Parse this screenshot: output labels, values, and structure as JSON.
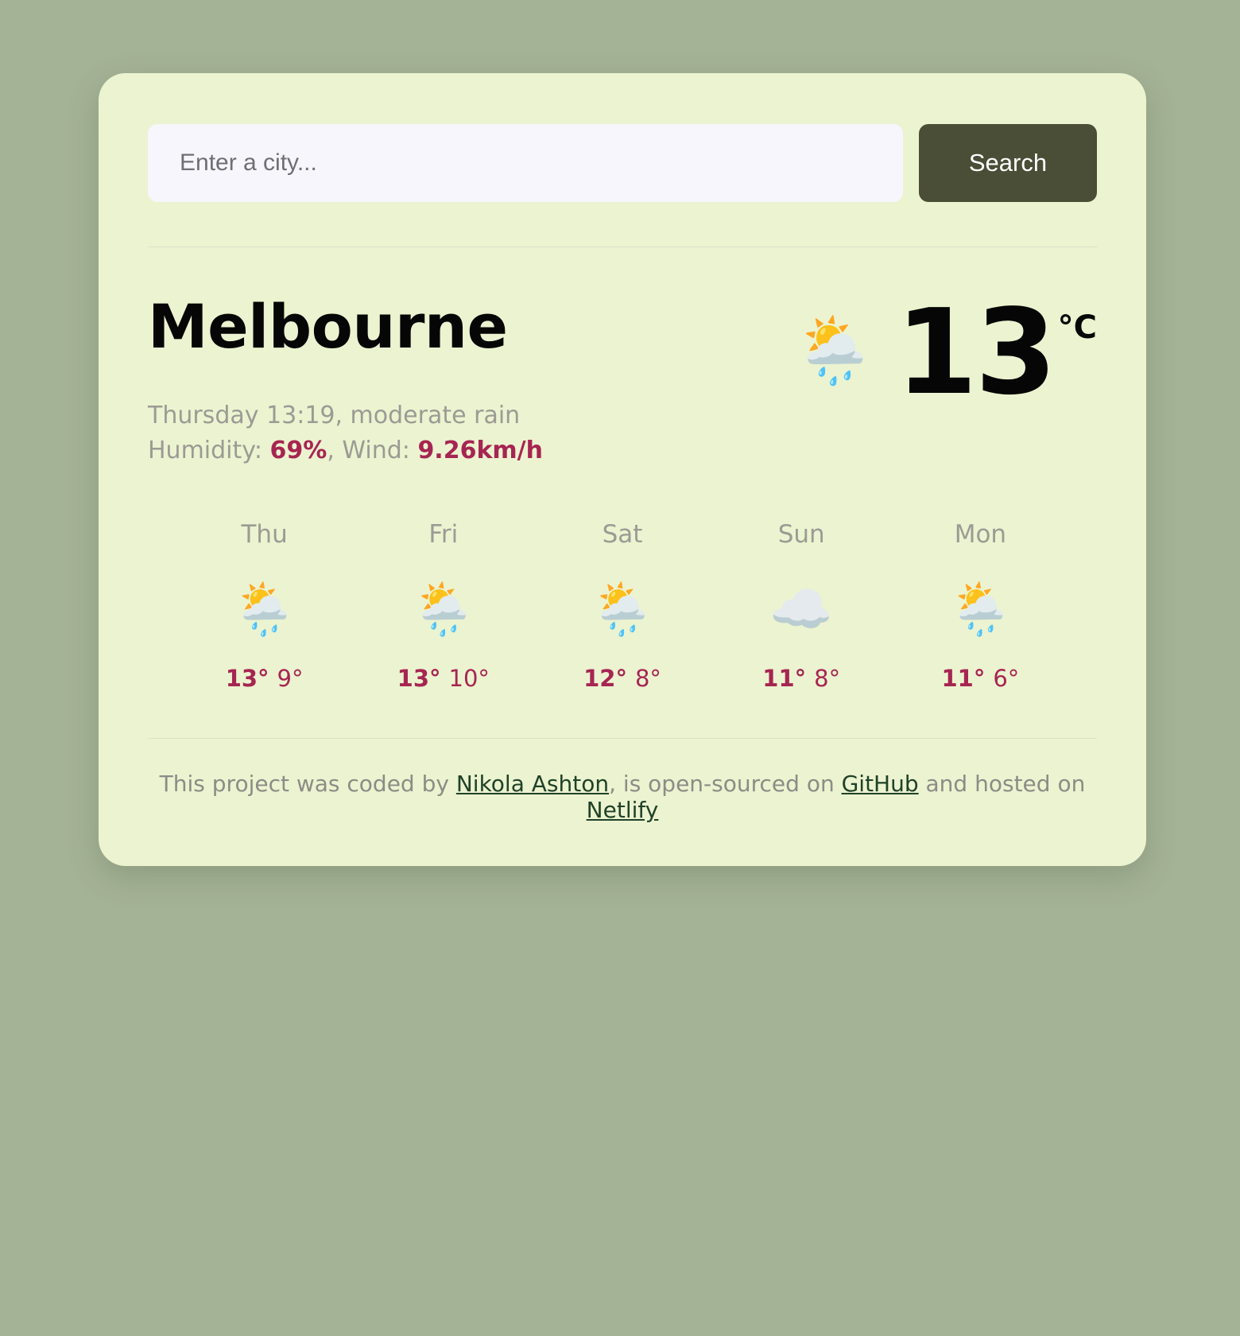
{
  "theme": {
    "page_background": "#a4b296",
    "card_background": "#ecf3d0",
    "input_background": "#f7f6fd",
    "button_background": "#4b4e36",
    "accent_color": "#a62552",
    "muted_text": "#9b9b94",
    "link_color": "#1f4228"
  },
  "search": {
    "placeholder": "Enter a city...",
    "value": "",
    "button_label": "Search"
  },
  "current": {
    "city": "Melbourne",
    "conditions_line": "Thursday 13:19, moderate rain",
    "humidity_label": "Humidity: ",
    "humidity_value": "69%",
    "separator": ", ",
    "wind_label": "Wind: ",
    "wind_value": "9.26km/h",
    "icon": "sun-behind-rain-cloud-icon",
    "icon_glyph": "🌦️",
    "temperature": "13",
    "unit": "°C"
  },
  "forecast": [
    {
      "day": "Thu",
      "icon": "sun-behind-rain-cloud-icon",
      "icon_glyph": "🌦️",
      "max": "13°",
      "min": "9°"
    },
    {
      "day": "Fri",
      "icon": "sun-behind-rain-cloud-icon",
      "icon_glyph": "🌦️",
      "max": "13°",
      "min": "10°"
    },
    {
      "day": "Sat",
      "icon": "sun-behind-rain-cloud-icon",
      "icon_glyph": "🌦️",
      "max": "12°",
      "min": "8°"
    },
    {
      "day": "Sun",
      "icon": "cloud-icon",
      "icon_glyph": "☁️",
      "max": "11°",
      "min": "8°"
    },
    {
      "day": "Mon",
      "icon": "sun-behind-rain-cloud-icon",
      "icon_glyph": "🌦️",
      "max": "11°",
      "min": "6°"
    }
  ],
  "footer": {
    "text_1": "This project was coded by ",
    "link_author": "Nikola Ashton",
    "text_2": ", is open-sourced on ",
    "link_github": "GitHub",
    "text_3": " and hosted on ",
    "link_netlify": "Netlify"
  }
}
